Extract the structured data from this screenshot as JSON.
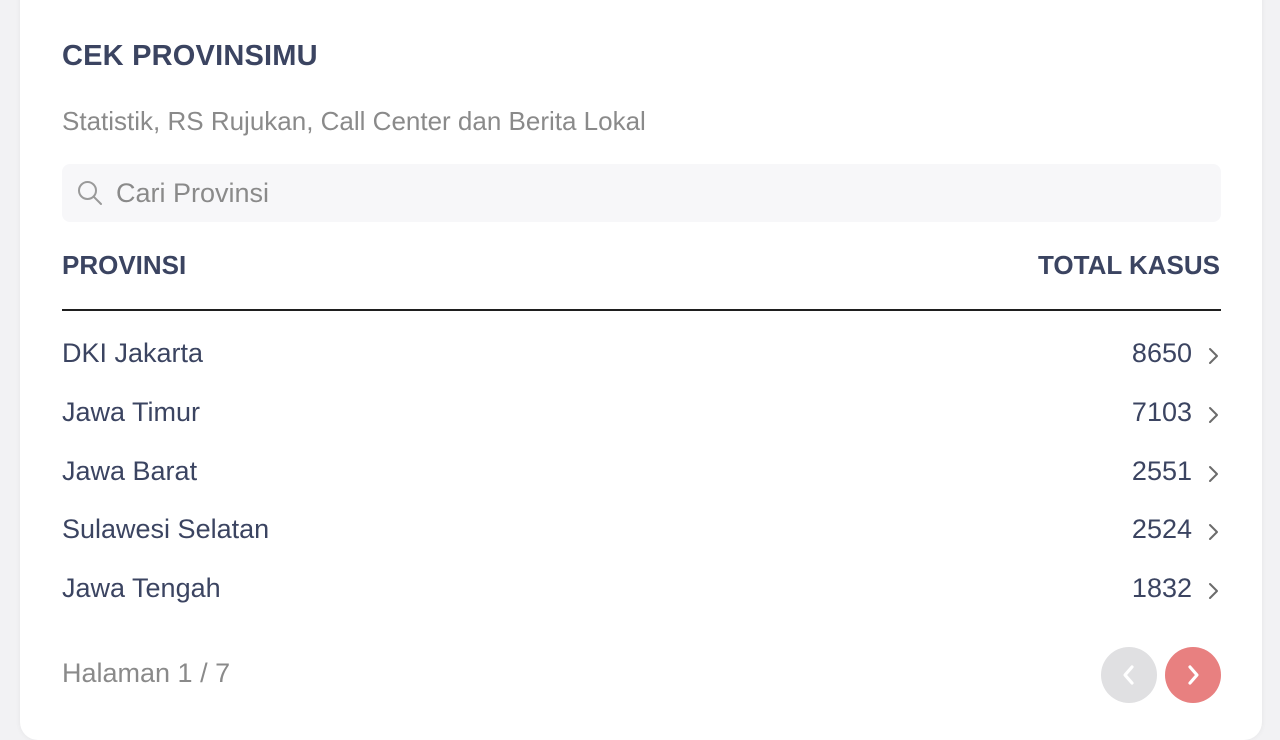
{
  "header": {
    "title": "CEK PROVINSIMU",
    "subtitle": "Statistik, RS Rujukan, Call Center dan Berita Lokal"
  },
  "search": {
    "placeholder": "Cari Provinsi",
    "value": "",
    "icon": "search-icon"
  },
  "table": {
    "columns": [
      "PROVINSI",
      "TOTAL KASUS"
    ],
    "rows": [
      {
        "name": "DKI Jakarta",
        "total": "8650"
      },
      {
        "name": "Jawa Timur",
        "total": "7103"
      },
      {
        "name": "Jawa Barat",
        "total": "2551"
      },
      {
        "name": "Sulawesi Selatan",
        "total": "2524"
      },
      {
        "name": "Jawa Tengah",
        "total": "1832"
      }
    ]
  },
  "pagination": {
    "label": "Halaman 1 / 7",
    "prev_icon": "chevron-left-icon",
    "next_icon": "chevron-right-icon"
  },
  "colors": {
    "text_primary": "#3b4461",
    "text_muted": "#8a8a8a",
    "prev_button_bg": "#e0e0e2",
    "next_button_bg": "#e88080",
    "search_bg": "#f7f7f9"
  }
}
